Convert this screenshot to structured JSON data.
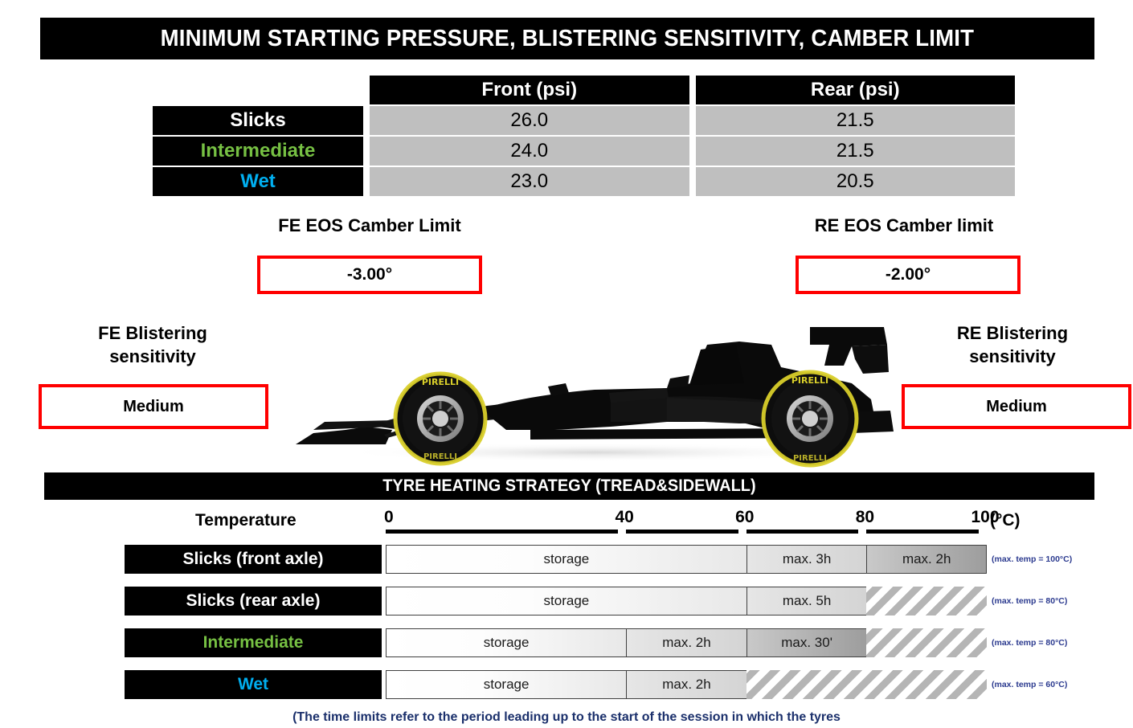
{
  "title": "MINIMUM STARTING PRESSURE, BLISTERING SENSITIVITY, CAMBER LIMIT",
  "pressure_table": {
    "headers": [
      "",
      "Front (psi)",
      "Rear (psi)"
    ],
    "rows": [
      {
        "label": "Slicks",
        "label_color": "#ffffff",
        "front": "26.0",
        "rear": "21.5"
      },
      {
        "label": "Intermediate",
        "label_color": "#76c043",
        "front": "24.0",
        "rear": "21.5"
      },
      {
        "label": "Wet",
        "label_color": "#00aeef",
        "front": "23.0",
        "rear": "20.5"
      }
    ]
  },
  "camber": {
    "front": {
      "title": "FE EOS Camber Limit",
      "value": "-3.00°"
    },
    "rear": {
      "title": "RE EOS Camber limit",
      "value": "-2.00°"
    }
  },
  "blistering": {
    "front": {
      "title_line1": "FE Blistering",
      "title_line2": "sensitivity",
      "value": "Medium"
    },
    "rear": {
      "title_line1": "RE Blistering",
      "title_line2": "sensitivity",
      "value": "Medium"
    }
  },
  "car": {
    "alt": "formula-one-car-side-view"
  },
  "heating": {
    "header": "TYRE HEATING STRATEGY (TREAD&SIDEWALL)",
    "axis": {
      "label": "Temperature",
      "unit": "(°C)",
      "ticks": [
        0,
        40,
        60,
        80,
        100
      ],
      "min": 0,
      "max": 100
    },
    "rows": [
      {
        "label": "Slicks (front axle)",
        "label_color": "#ffffff",
        "note": "(max. temp = 100°C)",
        "segments": [
          {
            "text": "storage",
            "from": 0,
            "to": 60,
            "style": "storage"
          },
          {
            "text": "max. 3h",
            "from": 60,
            "to": 80,
            "style": "warm"
          },
          {
            "text": "max. 2h",
            "from": 80,
            "to": 100,
            "style": "hot"
          }
        ]
      },
      {
        "label": "Slicks (rear axle)",
        "label_color": "#ffffff",
        "note": "(max. temp = 80°C)",
        "segments": [
          {
            "text": "storage",
            "from": 0,
            "to": 60,
            "style": "storage"
          },
          {
            "text": "max. 5h",
            "from": 60,
            "to": 80,
            "style": "warm"
          },
          {
            "text": "",
            "from": 80,
            "to": 100,
            "style": "hatch"
          }
        ]
      },
      {
        "label": "Intermediate",
        "label_color": "#76c043",
        "note": "(max. temp = 80°C)",
        "segments": [
          {
            "text": "storage",
            "from": 0,
            "to": 40,
            "style": "storage"
          },
          {
            "text": "max. 2h",
            "from": 40,
            "to": 60,
            "style": "warm"
          },
          {
            "text": "max. 30'",
            "from": 60,
            "to": 80,
            "style": "hot"
          },
          {
            "text": "",
            "from": 80,
            "to": 100,
            "style": "hatch"
          }
        ]
      },
      {
        "label": "Wet",
        "label_color": "#00aeef",
        "note": "(max. temp = 60°C)",
        "segments": [
          {
            "text": "storage",
            "from": 0,
            "to": 40,
            "style": "storage"
          },
          {
            "text": "max. 2h",
            "from": 40,
            "to": 60,
            "style": "warm"
          },
          {
            "text": "",
            "from": 60,
            "to": 100,
            "style": "hatch"
          }
        ]
      }
    ]
  },
  "footer_note": "(The time limits refer to the period leading up to the start of the session in which the tyres"
}
